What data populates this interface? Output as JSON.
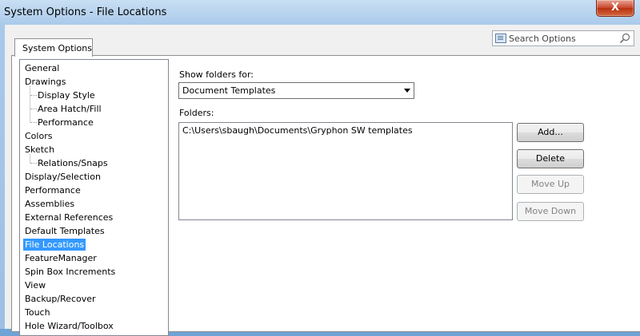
{
  "window": {
    "title": "System Options - File Locations",
    "close_glyph": "X"
  },
  "tab": {
    "label": "System Options"
  },
  "search": {
    "placeholder": "Search Options",
    "icon": "list-icon",
    "magnifier_icon": "search-icon"
  },
  "tree": {
    "items": [
      {
        "label": "General",
        "level": 0
      },
      {
        "label": "Drawings",
        "level": 0
      },
      {
        "label": "Display Style",
        "level": 1
      },
      {
        "label": "Area Hatch/Fill",
        "level": 1
      },
      {
        "label": "Performance",
        "level": 1
      },
      {
        "label": "Colors",
        "level": 0
      },
      {
        "label": "Sketch",
        "level": 0
      },
      {
        "label": "Relations/Snaps",
        "level": 1
      },
      {
        "label": "Display/Selection",
        "level": 0
      },
      {
        "label": "Performance",
        "level": 0
      },
      {
        "label": "Assemblies",
        "level": 0
      },
      {
        "label": "External References",
        "level": 0
      },
      {
        "label": "Default Templates",
        "level": 0
      },
      {
        "label": "File Locations",
        "level": 0,
        "selected": true
      },
      {
        "label": "FeatureManager",
        "level": 0
      },
      {
        "label": "Spin Box Increments",
        "level": 0
      },
      {
        "label": "View",
        "level": 0
      },
      {
        "label": "Backup/Recover",
        "level": 0
      },
      {
        "label": "Touch",
        "level": 0
      },
      {
        "label": "Hole Wizard/Toolbox",
        "level": 0
      }
    ]
  },
  "main": {
    "show_folders_label": "Show folders for:",
    "show_folders_value": "Document Templates",
    "folders_label": "Folders:",
    "folders": [
      "C:\\Users\\sbaugh\\Documents\\Gryphon SW templates"
    ],
    "buttons": {
      "add": "Add...",
      "delete": "Delete",
      "move_up": "Move Up",
      "move_down": "Move Down"
    }
  },
  "colors": {
    "selection": "#3399ff",
    "close_button": "#c7462c"
  }
}
